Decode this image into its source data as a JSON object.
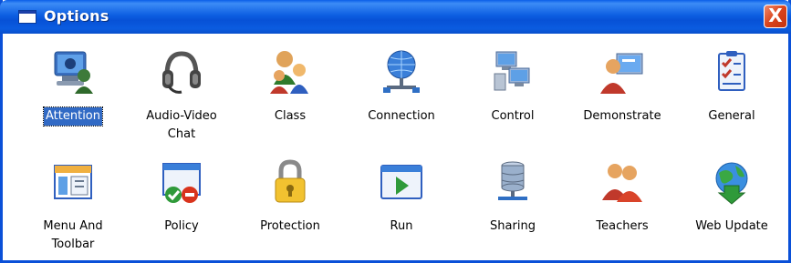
{
  "window": {
    "title": "Options",
    "close_label": "X"
  },
  "items": [
    {
      "label": "Attention",
      "icon": "attention-icon",
      "selected": true
    },
    {
      "label": "Audio-Video\nChat",
      "icon": "headset-icon"
    },
    {
      "label": "Class",
      "icon": "class-icon"
    },
    {
      "label": "Connection",
      "icon": "globe-network-icon"
    },
    {
      "label": "Control",
      "icon": "computers-control-icon"
    },
    {
      "label": "Demonstrate",
      "icon": "demonstrate-icon"
    },
    {
      "label": "General",
      "icon": "checklist-icon"
    },
    {
      "label": "Menu And\nToolbar",
      "icon": "menu-toolbar-icon"
    },
    {
      "label": "Policy",
      "icon": "policy-icon"
    },
    {
      "label": "Protection",
      "icon": "padlock-icon"
    },
    {
      "label": "Run",
      "icon": "run-play-icon"
    },
    {
      "label": "Sharing",
      "icon": "database-sharing-icon"
    },
    {
      "label": "Teachers",
      "icon": "teachers-icon"
    },
    {
      "label": "Web Update",
      "icon": "web-update-icon"
    }
  ]
}
